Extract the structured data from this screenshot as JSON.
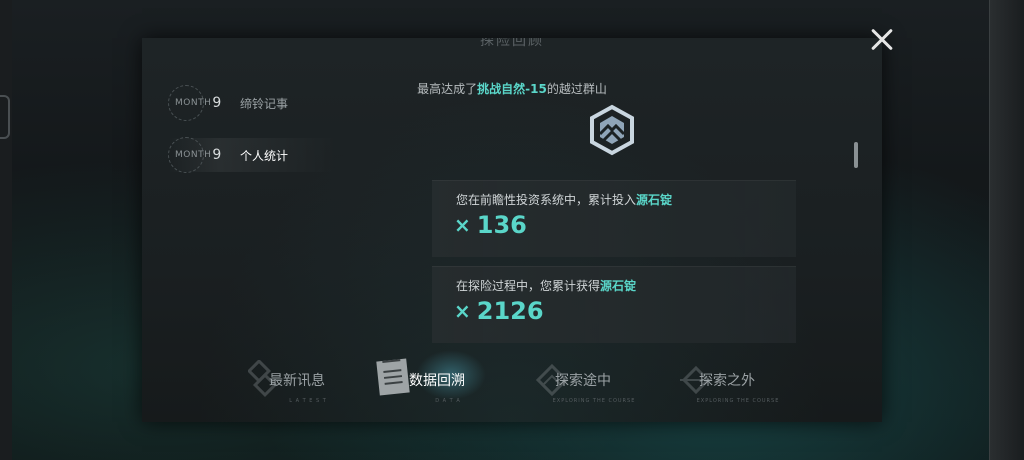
{
  "panel": {
    "title": "探险回顾"
  },
  "sidebar": {
    "items": [
      {
        "month_word": "MONTH",
        "month_num": "9",
        "label": "缔铃记事"
      },
      {
        "month_word": "MONTH",
        "month_num": "9",
        "label": "个人统计"
      }
    ]
  },
  "summary": {
    "prefix": "最高达成了",
    "highlight": "挑战自然-15",
    "suffix": "的越过群山"
  },
  "stats": [
    {
      "text": "您在前瞻性投资系统中，累计投入",
      "highlight": "源石锭",
      "mult": "×",
      "value": "136"
    },
    {
      "text": "在探险过程中，您累计获得",
      "highlight": "源石锭",
      "mult": "×",
      "value": "2126"
    }
  ],
  "tabs": [
    {
      "label": "最新讯息",
      "sub": "L A T E S T"
    },
    {
      "label": "数据回溯",
      "sub": "D A T A"
    },
    {
      "label": "探索途中",
      "sub": "EXPLORING THE COURSE"
    },
    {
      "label": "探索之外",
      "sub": "EXPLORING THE COURSE"
    }
  ],
  "colors": {
    "accent": "#5ad6c9",
    "panel": "#1c2123"
  }
}
